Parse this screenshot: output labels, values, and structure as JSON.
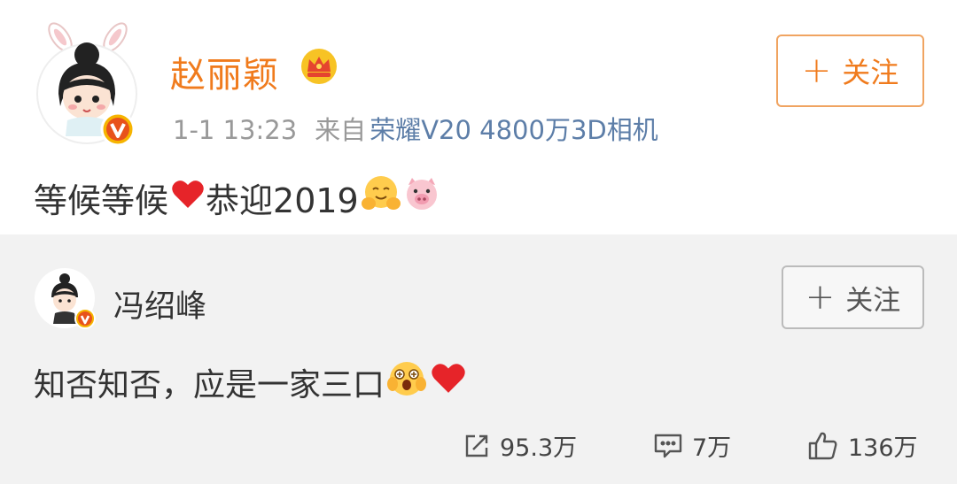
{
  "post": {
    "author": "赵丽颖",
    "time": "1-1 13:23",
    "source_label": "来自",
    "device": "荣耀V20 4800万3D相机",
    "follow_label": "关注",
    "text": "等候等候",
    "text_after_heart": "恭迎2019",
    "icons": [
      "crown-badge-icon",
      "verified-v-icon",
      "red-heart-emoji",
      "hug-emoji",
      "pig-emoji"
    ]
  },
  "repost": {
    "author": "冯绍峰",
    "follow_label": "关注",
    "text": "知否知否，应是一家三口",
    "icons": [
      "verified-v-icon",
      "astonished-emoji",
      "red-heart-emoji"
    ]
  },
  "stats": {
    "reposts": "95.3万",
    "comments": "7万",
    "likes": "136万"
  },
  "colors": {
    "brand_orange": "#f07b1d",
    "link_blue": "#5d7ea8",
    "repost_bg": "#f2f2f2"
  }
}
